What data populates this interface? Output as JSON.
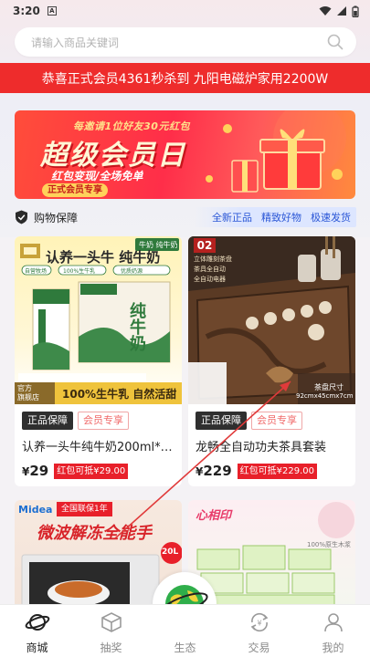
{
  "status_bar": {
    "time": "3:20",
    "notification_glyph": "A"
  },
  "search": {
    "placeholder": "请输入商品关键词"
  },
  "marquee": {
    "text": "恭喜正式会员4361秒杀到 九阳电磁炉家用2200W"
  },
  "banner": {
    "top_text": "每邀请1位好友30元红包",
    "title": "超级会员日",
    "subtitle": "红包变现/全场免单",
    "tag": "正式会员专享"
  },
  "guarantee": {
    "label": "购物保障",
    "features": [
      "全新正品",
      "精致好物",
      "极速发货"
    ]
  },
  "products": [
    {
      "name": "认养一头牛纯牛奶200ml*…",
      "badge_primary": "正品保障",
      "badge_secondary": "会员专享",
      "price_symbol": "¥",
      "price": "29",
      "coupon": "红包可抵¥29.00",
      "image_text": {
        "headline": "认养一头牛 纯牛奶",
        "tag": "牛奶 纯牛奶",
        "chips": [
          "自营牧场",
          "100%生牛乳",
          "优质奶源"
        ],
        "box_label": "纯牛奶",
        "strip_left": "官方\n旗舰店",
        "strip_right": "100%生牛乳 自然活甜"
      }
    },
    {
      "name": "龙畅全自动功夫茶具套装",
      "badge_primary": "正品保障",
      "badge_secondary": "会员专享",
      "price_symbol": "¥",
      "price": "229",
      "coupon": "红包可抵¥229.00",
      "image_text": {
        "number": "02",
        "features": [
          "立体雕刻茶盘",
          "茶具全自动",
          "全自动电器"
        ],
        "size_label": "茶盘尺寸",
        "size_value": "92cmx45cmx7cm"
      }
    }
  ],
  "partial_products": [
    {
      "brand": "Midea",
      "tag": "全国联保1年",
      "headline": "微波解冻全能手",
      "capacity": "20L"
    },
    {
      "brand": "心相印",
      "badge": "100%原生木浆"
    }
  ],
  "bottom_nav": {
    "items": [
      {
        "label": "商城",
        "icon": "planet-icon",
        "active": true
      },
      {
        "label": "抽奖",
        "icon": "box-icon",
        "active": false
      },
      {
        "label": "生态",
        "icon": "globe-icon",
        "active": false
      },
      {
        "label": "交易",
        "icon": "exchange-icon",
        "active": false
      },
      {
        "label": "我的",
        "icon": "profile-icon",
        "active": false
      }
    ]
  },
  "colors": {
    "accent_red": "#ee2c2c",
    "link_blue": "#2a56d6",
    "badge_dark": "#2f2f2f",
    "coupon_red": "#e8202a"
  }
}
